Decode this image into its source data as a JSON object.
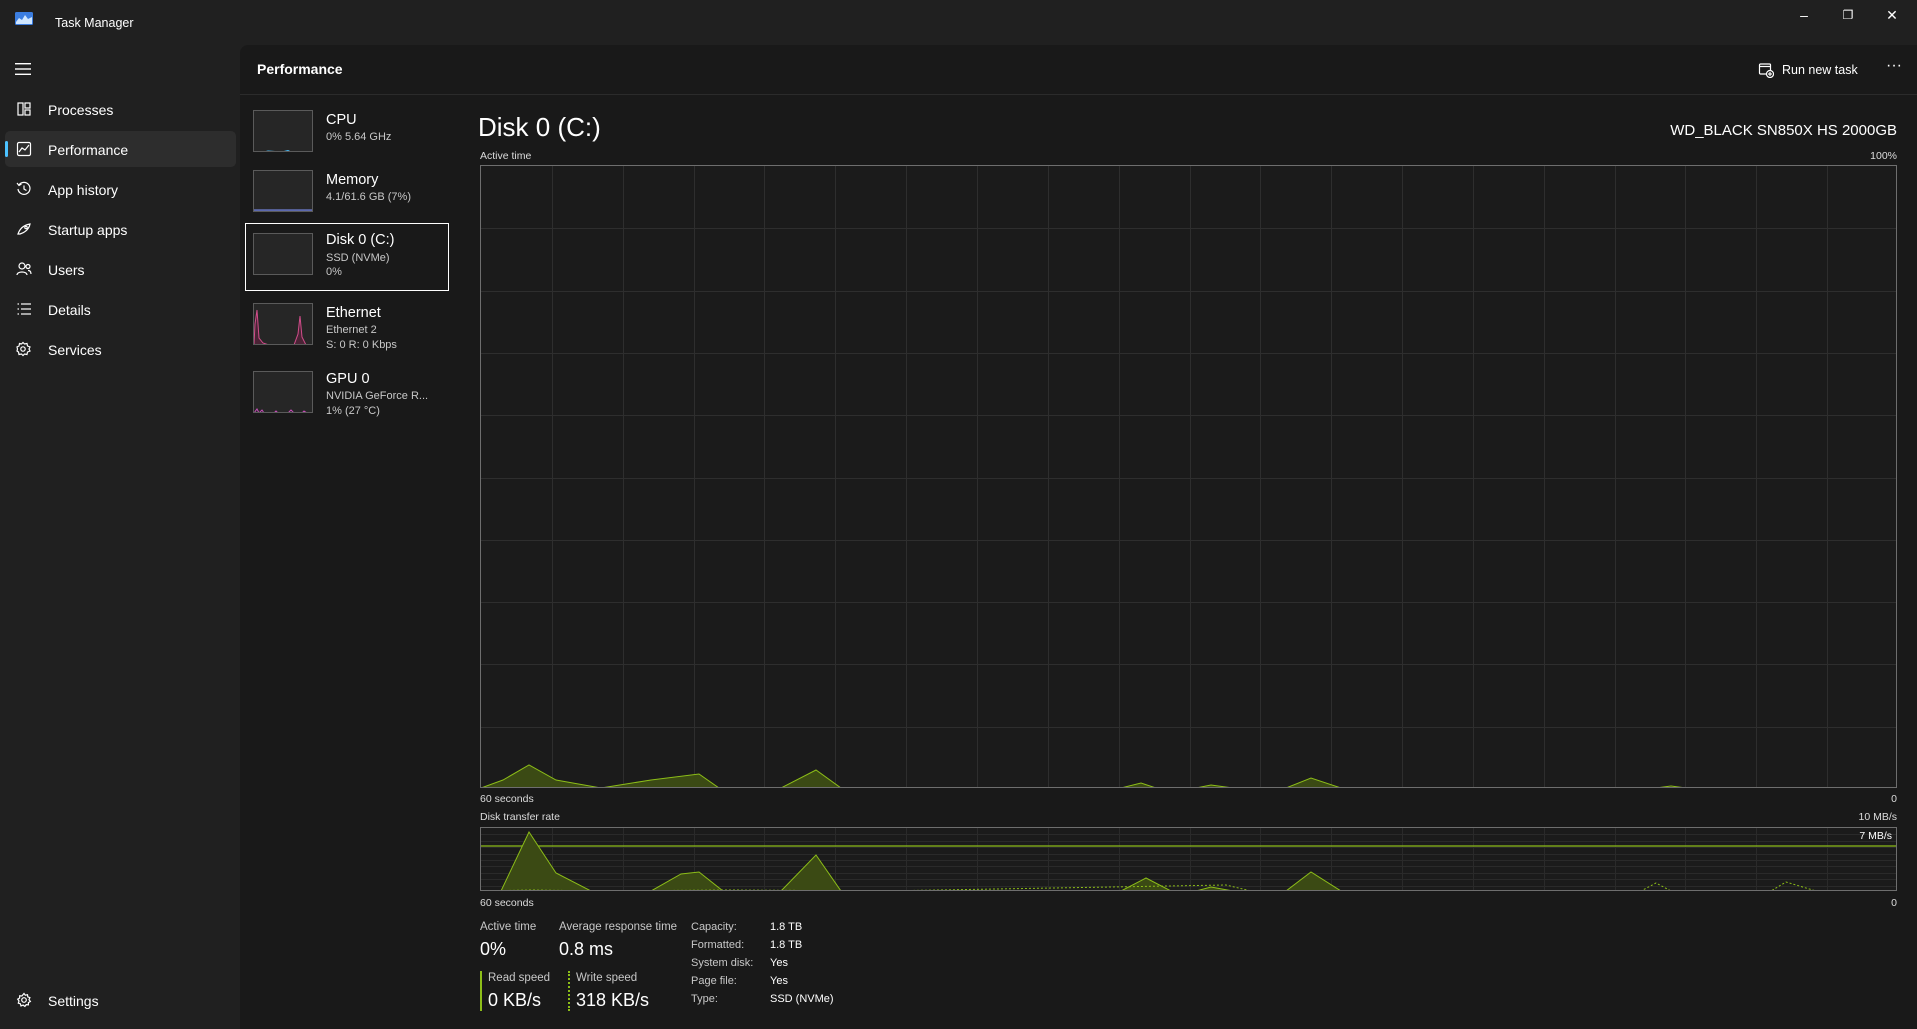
{
  "window": {
    "title": "Task Manager",
    "minimize_glyph": "–",
    "restore_glyph": "❐",
    "close_glyph": "✕"
  },
  "nav": {
    "items": [
      {
        "label": "Processes",
        "icon": "processes-icon"
      },
      {
        "label": "Performance",
        "icon": "performance-icon",
        "active": true
      },
      {
        "label": "App history",
        "icon": "history-icon"
      },
      {
        "label": "Startup apps",
        "icon": "startup-icon"
      },
      {
        "label": "Users",
        "icon": "users-icon"
      },
      {
        "label": "Details",
        "icon": "details-icon"
      },
      {
        "label": "Services",
        "icon": "services-icon"
      }
    ],
    "settings_label": "Settings"
  },
  "header": {
    "title": "Performance",
    "run_new_task_label": "Run new task",
    "more_glyph": "···"
  },
  "resources": [
    {
      "name": "CPU",
      "line1": "0%  5.64 GHz",
      "line2": ""
    },
    {
      "name": "Memory",
      "line1": "4.1/61.6 GB (7%)",
      "line2": ""
    },
    {
      "name": "Disk 0 (C:)",
      "line1": "SSD (NVMe)",
      "line2": "0%",
      "selected": true
    },
    {
      "name": "Ethernet",
      "line1": "Ethernet 2",
      "line2": "S: 0 R: 0 Kbps"
    },
    {
      "name": "GPU 0",
      "line1": "NVIDIA GeForce R...",
      "line2": "1%  (27 °C)"
    }
  ],
  "detail": {
    "title": "Disk 0 (C:)",
    "model": "WD_BLACK SN850X HS 2000GB",
    "active_time_chart": {
      "label": "Active time",
      "max_label": "100%",
      "time_label": "60 seconds",
      "min_label": "0"
    },
    "transfer_chart": {
      "label": "Disk transfer rate",
      "max_label": "10 MB/s",
      "line_label": "7 MB/s",
      "time_label": "60 seconds",
      "min_label": "0"
    },
    "stats": {
      "active_time_label": "Active time",
      "active_time_value": "0%",
      "avg_response_label": "Average response time",
      "avg_response_value": "0.8 ms",
      "read_speed_label": "Read speed",
      "read_speed_value": "0 KB/s",
      "write_speed_label": "Write speed",
      "write_speed_value": "318 KB/s"
    },
    "properties": [
      {
        "key": "Capacity:",
        "value": "1.8 TB"
      },
      {
        "key": "Formatted:",
        "value": "1.8 TB"
      },
      {
        "key": "System disk:",
        "value": "Yes"
      },
      {
        "key": "Page file:",
        "value": "Yes"
      },
      {
        "key": "Type:",
        "value": "SSD (NVMe)"
      }
    ]
  },
  "colors": {
    "accent": "#4cc2ff",
    "disk_line": "#8cbd18",
    "disk_fill": "#3b4a14",
    "ethernet_line": "#d14d8b",
    "gpu_line": "#c64db8",
    "memory_line": "#6f7fd4"
  }
}
